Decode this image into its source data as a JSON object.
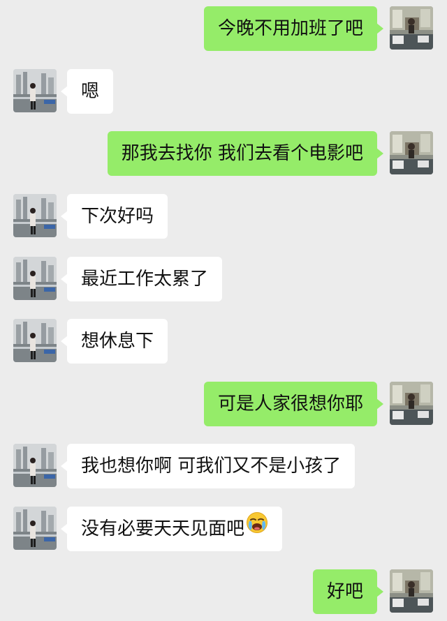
{
  "messages": [
    {
      "side": "out",
      "text": "今晚不用加班了吧"
    },
    {
      "side": "in",
      "text": "嗯"
    },
    {
      "side": "out",
      "text": "那我去找你 我们去看个电影吧"
    },
    {
      "side": "in",
      "text": "下次好吗"
    },
    {
      "side": "in",
      "text": "最近工作太累了"
    },
    {
      "side": "in",
      "text": "想休息下"
    },
    {
      "side": "out",
      "text": "可是人家很想你耶"
    },
    {
      "side": "in",
      "text": "我也想你啊 可我们又不是小孩了"
    },
    {
      "side": "in",
      "text": "没有必要天天见面吧",
      "emoji": "loudly-crying-face-icon"
    },
    {
      "side": "out",
      "text": "好吧"
    }
  ],
  "colors": {
    "background": "#ececec",
    "outgoing_bubble": "#95ec69",
    "incoming_bubble": "#ffffff"
  }
}
